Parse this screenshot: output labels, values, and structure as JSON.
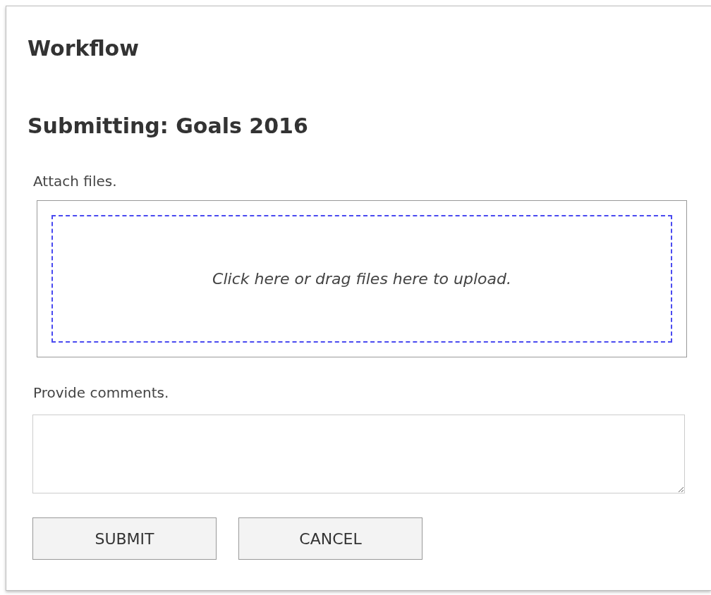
{
  "title": "Workflow",
  "subtitle": "Submitting: Goals 2016",
  "attach": {
    "label": "Attach files.",
    "dropzone_text": "Click here or drag files here to upload."
  },
  "comments": {
    "label": "Provide comments."
  },
  "buttons": [
    "SUBMIT",
    "CANCEL"
  ]
}
